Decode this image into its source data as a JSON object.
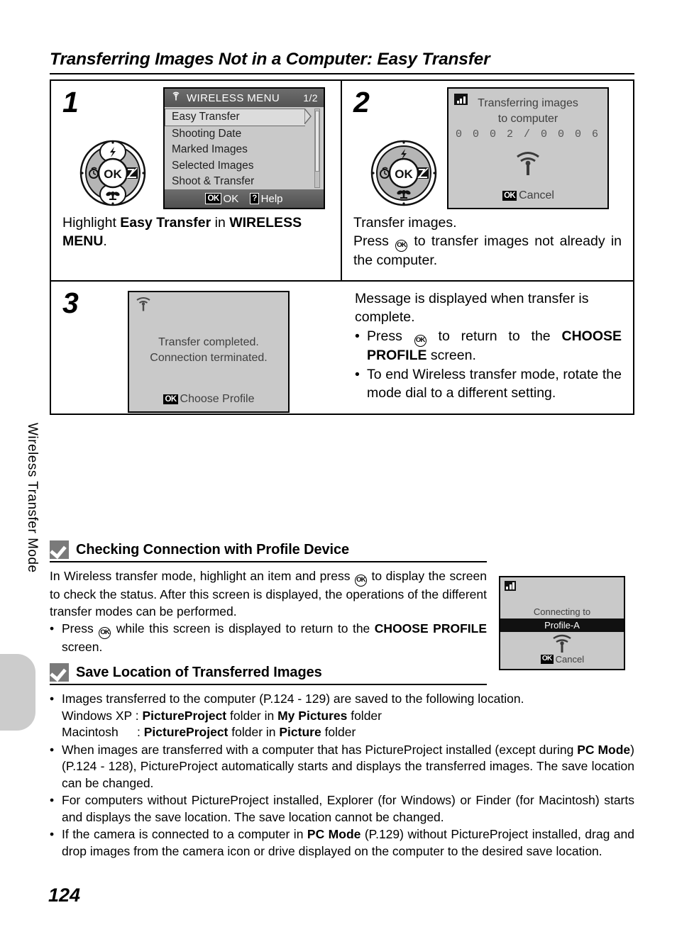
{
  "page": {
    "title": "Transferring Images Not in a Computer: Easy Transfer",
    "number": "124",
    "side_label": "Wireless Transfer Mode"
  },
  "steps": [
    {
      "number": "1",
      "lcd": {
        "type": "menu",
        "icon": "wifi-icon",
        "header_title": "WIRELESS MENU",
        "header_page": "1/2",
        "items": [
          "Easy Transfer",
          "Shooting Date",
          "Marked Images",
          "Selected Images",
          "Shoot & Transfer"
        ],
        "selected_index": 0,
        "footer": [
          {
            "glyph": "OK",
            "label": "OK"
          },
          {
            "glyph": "?",
            "label": "Help"
          }
        ]
      },
      "caption_parts": [
        {
          "text": "Highlight ",
          "bold": false
        },
        {
          "text": "Easy Transfer",
          "bold": true
        },
        {
          "text": " in ",
          "bold": false
        },
        {
          "text": "WIRELESS MENU",
          "bold": true
        },
        {
          "text": ".",
          "bold": false
        }
      ]
    },
    {
      "number": "2",
      "lcd": {
        "type": "progress",
        "icon": "signal-bars-icon",
        "line1": "Transferring images",
        "line2": "to computer",
        "count": "0 0 0 2 / 0 0 0 6",
        "wireless_icon": "wireless-signal-icon",
        "action_glyph": "OK",
        "action_label": "Cancel"
      },
      "caption_title": "Transfer images.",
      "caption_body_pre": "Press ",
      "caption_body_post": " to transfer images not already in the computer."
    },
    {
      "number": "3",
      "lcd": {
        "type": "message",
        "icon": "wireless-signal-icon",
        "line1": "Transfer completed.",
        "line2": "Connection terminated.",
        "action_glyph": "OK",
        "action_label": "Choose Profile"
      },
      "caption_title": "Message is displayed when transfer is complete.",
      "bullets": [
        {
          "pre": "Press ",
          "glyph": "OK",
          "mid": " to return to the ",
          "bold": "CHOOSE PROFILE",
          "post": " screen."
        },
        {
          "plain": "To end Wireless transfer mode, rotate the mode dial to a different setting."
        }
      ]
    }
  ],
  "notes": [
    {
      "icon": "check-mark-icon",
      "title": "Checking Connection with Profile Device",
      "paragraph_pre": "In Wireless transfer mode, highlight an item and press ",
      "paragraph_post": " to display the screen to check the status. After this screen is displayed, the operations of the different transfer modes can be performed.",
      "bullets": [
        {
          "pre": "Press ",
          "glyph": "OK",
          "mid": " while this screen is displayed to return to the ",
          "bold": "CHOOSE PROFILE",
          "post": " screen."
        }
      ],
      "lcd": {
        "type": "connecting",
        "icon": "signal-bars-icon",
        "line1": "Connecting to",
        "highlight": "Profile-A",
        "wireless_icon": "wireless-signal-icon",
        "action_glyph": "OK",
        "action_label": "Cancel"
      }
    },
    {
      "icon": "check-mark-icon",
      "title": "Save Location of Transferred Images",
      "bullets": [
        {
          "line1": "Images transferred to the computer (P.124 - 129) are saved to the following location.",
          "line2_pre": "Windows XP : ",
          "line2_b1": "PictureProject",
          "line2_mid": " folder in ",
          "line2_b2": "My Pictures",
          "line2_post": " folder",
          "line3_pre": "Macintosh  : ",
          "line3_b1": "PictureProject",
          "line3_mid": " folder in ",
          "line3_b2": "Picture",
          "line3_post": " folder"
        },
        {
          "pre": "When images are transferred with a computer that has PictureProject installed (except during ",
          "bold": "PC Mode",
          "post": ") (P.124 - 128), PictureProject automatically starts and displays the transferred images. The save location can be changed."
        },
        {
          "plain": "For computers without PictureProject installed, Explorer (for Windows) or Finder (for Macintosh) starts and displays the save location. The save location cannot be changed."
        },
        {
          "pre": "If the camera is connected to a computer in ",
          "bold": "PC Mode",
          "post": " (P.129) without PictureProject installed, drag and drop images from the camera icon or drive displayed on the computer to the desired save location."
        }
      ]
    }
  ],
  "dial": {
    "center_label": "OK",
    "top_icon": "flash-icon",
    "left_icon": "self-timer-icon",
    "right_icon": "exposure-compensation-icon",
    "bottom_icon": "macro-flower-icon"
  }
}
